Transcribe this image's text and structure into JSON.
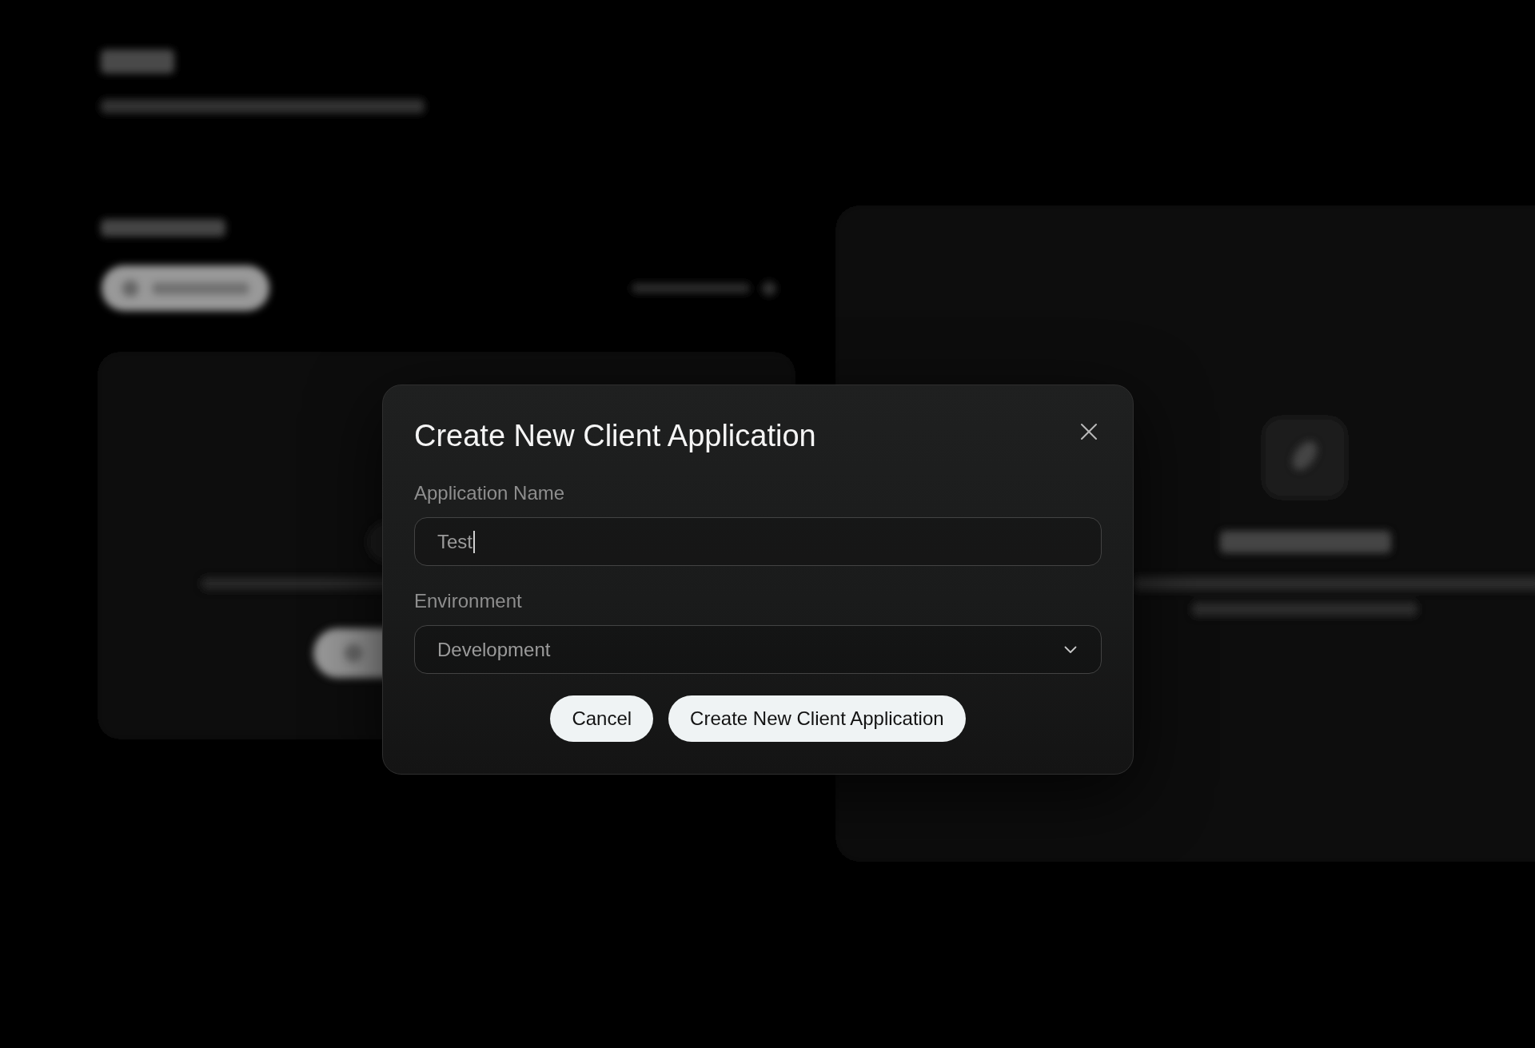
{
  "dialog": {
    "title": "Create New Client Application",
    "fields": [
      {
        "kind": "text",
        "label": "Application Name",
        "value": "Test",
        "focused": true
      },
      {
        "kind": "select",
        "label": "Environment",
        "value": "Development"
      }
    ],
    "buttons": [
      "Cancel",
      "Create New Client Application"
    ]
  }
}
